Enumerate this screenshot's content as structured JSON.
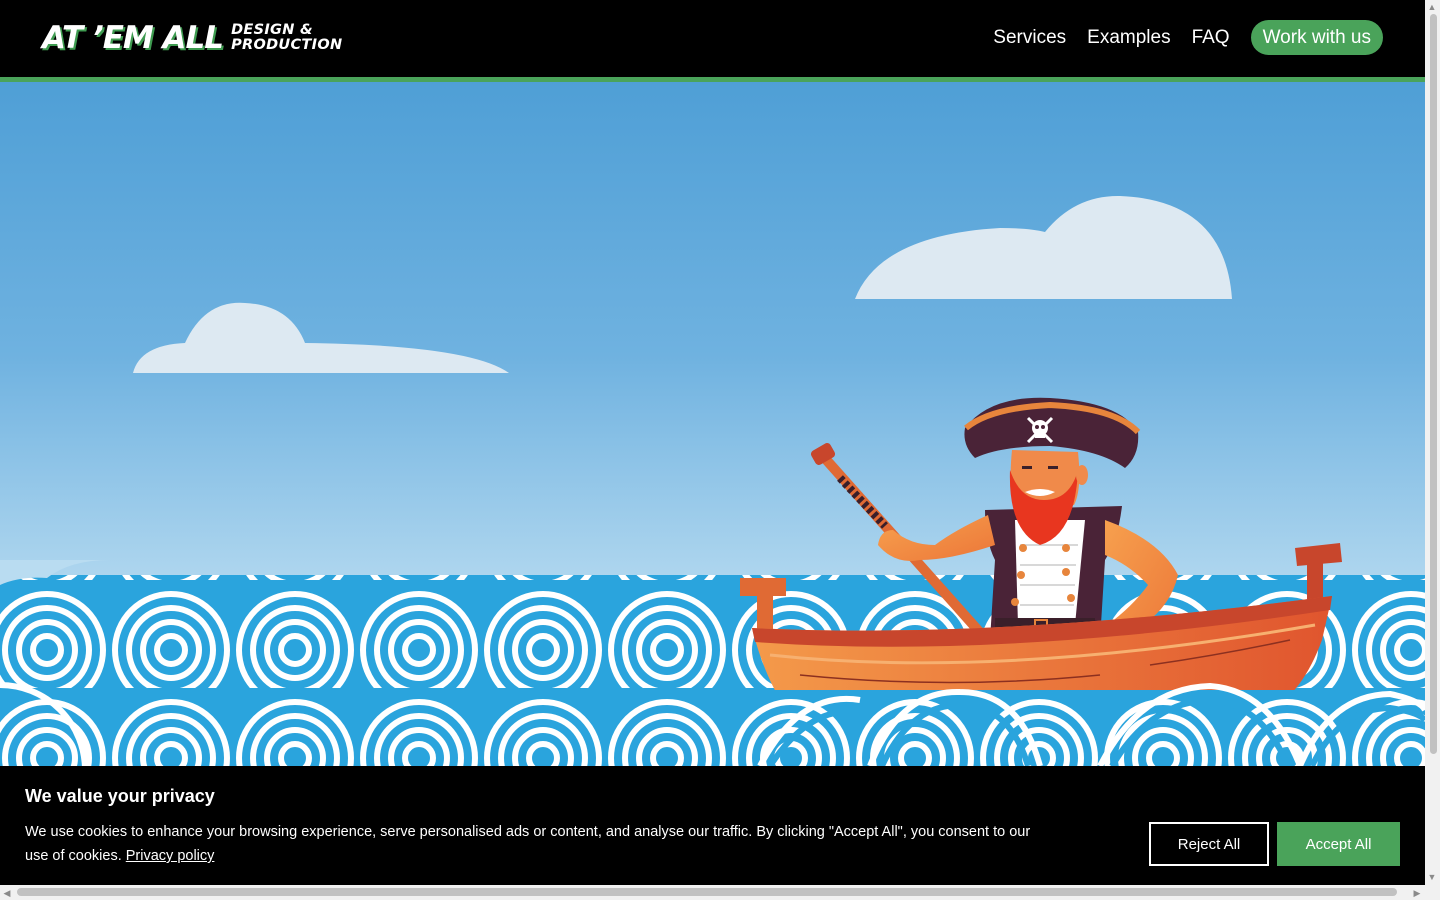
{
  "header": {
    "logo_main": "AT ’EM ALL",
    "logo_line1": "DESIGN &",
    "logo_line2": "PRODUCTION",
    "nav": [
      {
        "label": "Services"
      },
      {
        "label": "Examples"
      },
      {
        "label": "FAQ"
      }
    ],
    "cta_label": "Work with us"
  },
  "cookie": {
    "title": "We value your privacy",
    "text": "We use cookies to enhance your browsing experience, serve personalised ads or content, and analyse our traffic. By clicking \"Accept All\", you consent to our use of cookies.",
    "link": "Privacy policy",
    "reject": "Reject All",
    "accept": "Accept All"
  },
  "colors": {
    "brand_green": "#4aa35a",
    "header_bg": "#000000",
    "sky_top": "#4f9fd6",
    "wave_blue": "#2aa4dd"
  },
  "icons": {
    "scroll_up": "▲",
    "scroll_down": "▼",
    "scroll_left": "◀",
    "scroll_right": "▶"
  }
}
